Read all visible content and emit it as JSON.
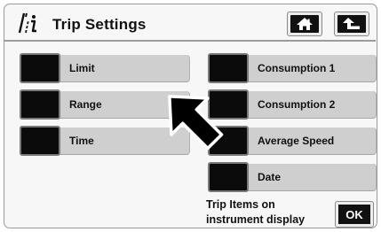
{
  "header": {
    "title": "Trip Settings",
    "title_icon": "trip-info-icon",
    "home_icon": "home-icon",
    "back_icon": "back-arrow-icon"
  },
  "left_items": [
    {
      "label": "Limit"
    },
    {
      "label": "Range"
    },
    {
      "label": "Time"
    }
  ],
  "right_items": [
    {
      "label": "Consumption 1"
    },
    {
      "label": "Consumption 2"
    },
    {
      "label": "Average Speed"
    },
    {
      "label": "Date"
    }
  ],
  "footer": {
    "line1": "Trip Items on",
    "line2": "instrument display",
    "ok_label": "OK"
  },
  "colors": {
    "button_face": "#cfcfcf",
    "checkbox_fill": "#0b0b0b",
    "header_rule": "#9c9c9c"
  },
  "pointer": "pointer-arrow-icon"
}
